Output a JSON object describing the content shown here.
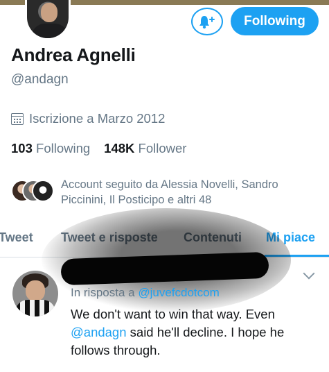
{
  "profile": {
    "name": "Andrea Agnelli",
    "handle": "@andagn",
    "joined": "Iscrizione a Marzo 2012",
    "following_count": "103",
    "following_label": "Following",
    "follower_count": "148K",
    "follower_label": "Follower",
    "followed_by": "Account seguito da Alessia Novelli, Sandro Piccinini, Il Posticipo e altri 48"
  },
  "actions": {
    "follow_button": "Following",
    "bell_icon": "bell-plus-icon"
  },
  "tabs": [
    {
      "label": "Tweet",
      "active": false
    },
    {
      "label": "Tweet e risposte",
      "active": false
    },
    {
      "label": "Contenuti",
      "active": false
    },
    {
      "label": "Mi piace",
      "active": true
    }
  ],
  "tweet": {
    "reply_prefix": "In risposta a",
    "reply_mention": "@juvefcdotcom",
    "text_part1": "We don't want to win that way. Even",
    "text_mention": "@andagn",
    "text_part2": "said he'll decline. I hope he follows through."
  },
  "colors": {
    "accent": "#1da1f2",
    "muted": "#657786",
    "text": "#14171a"
  }
}
